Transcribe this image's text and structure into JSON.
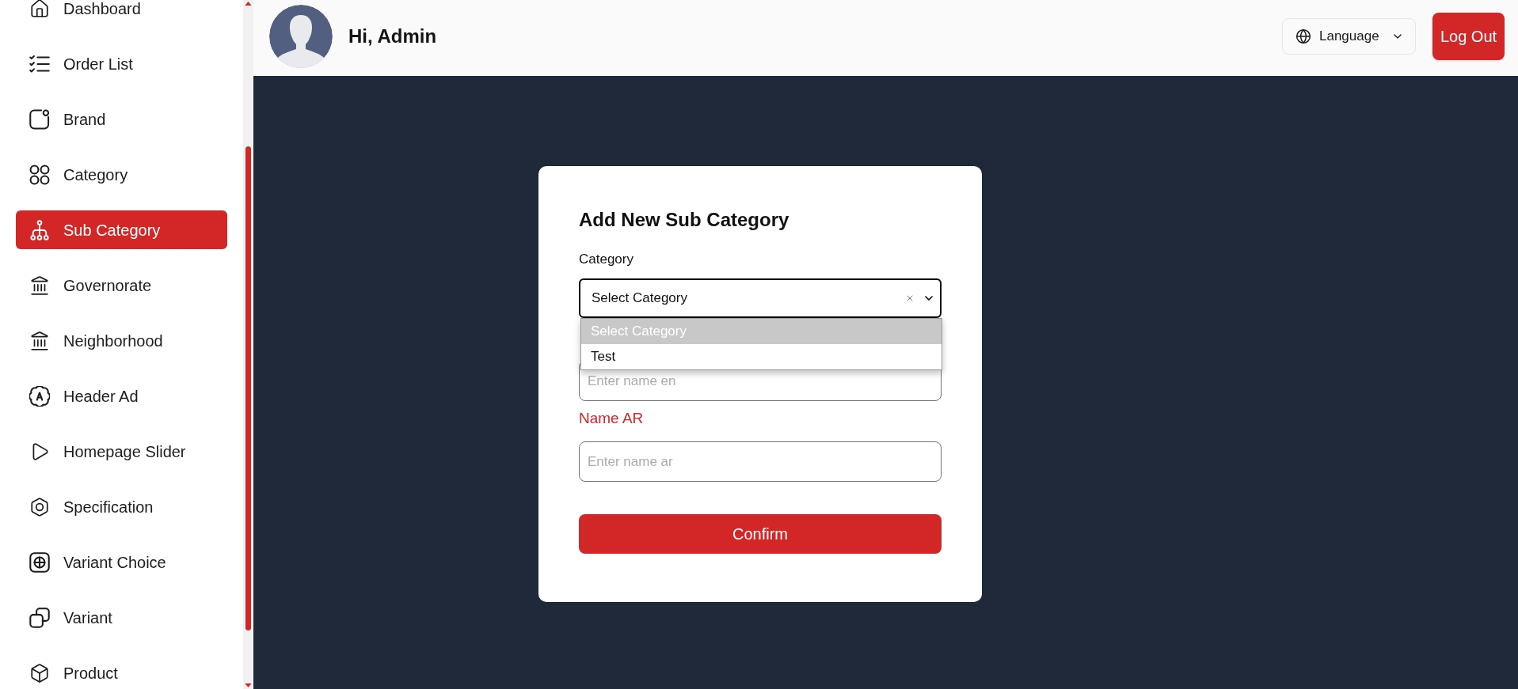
{
  "sidebar": {
    "items": [
      {
        "label": "Dashboard",
        "selected": false
      },
      {
        "label": "Order List",
        "selected": false
      },
      {
        "label": "Brand",
        "selected": false
      },
      {
        "label": "Category",
        "selected": false
      },
      {
        "label": "Sub Category",
        "selected": true
      },
      {
        "label": "Governorate",
        "selected": false
      },
      {
        "label": "Neighborhood",
        "selected": false
      },
      {
        "label": "Header Ad",
        "selected": false
      },
      {
        "label": "Homepage Slider",
        "selected": false
      },
      {
        "label": "Specification",
        "selected": false
      },
      {
        "label": "Variant Choice",
        "selected": false
      },
      {
        "label": "Variant",
        "selected": false
      },
      {
        "label": "Product",
        "selected": false
      }
    ]
  },
  "header": {
    "greeting": "Hi, Admin",
    "language_button": "Language",
    "logout_button": "Log Out"
  },
  "form": {
    "title": "Add New Sub Category",
    "category_field": {
      "label": "Category",
      "value": "Select Category",
      "expanded": true,
      "options": [
        {
          "label": "Select Category",
          "selected": true
        },
        {
          "label": "Test",
          "selected": false
        }
      ]
    },
    "name_en_field": {
      "placeholder": "Enter name en"
    },
    "name_ar_field": {
      "label": "Name AR",
      "invalid": true,
      "placeholder": "Enter name ar"
    },
    "confirm_button": "Confirm"
  }
}
